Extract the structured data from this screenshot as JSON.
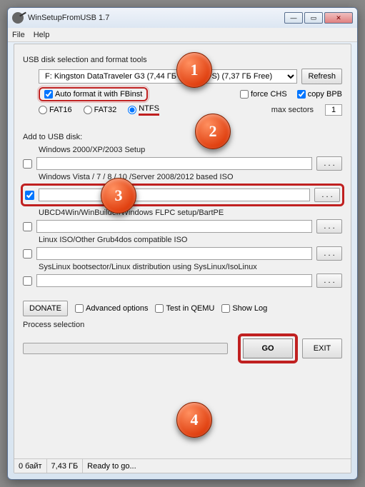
{
  "title": "WinSetupFromUSB 1.7",
  "menu": {
    "file": "File",
    "help": "Help"
  },
  "section1": "USB disk selection and format tools",
  "drive": "F: Kingston DataTraveler G3 (7,44 ГБ Tot) (NTFS) (7,37 ГБ Free)",
  "refresh": "Refresh",
  "autoformat": "Auto format it with FBinst",
  "forceCHS": "force CHS",
  "copyBPB": "copy BPB",
  "fs": {
    "fat16": "FAT16",
    "fat32": "FAT32",
    "ntfs": "NTFS"
  },
  "maxsectors_label": "max sectors",
  "maxsectors_val": "1",
  "section2": "Add to USB disk:",
  "opt1": {
    "label": "Windows 2000/XP/2003 Setup"
  },
  "opt2": {
    "label": "Windows Vista / 7 / 8 / 10 /Server 2008/2012 based ISO"
  },
  "opt3": {
    "label": "UBCD4Win/WinBuilder/Windows FLPC setup/BartPE"
  },
  "opt4": {
    "label": "Linux ISO/Other Grub4dos compatible ISO"
  },
  "opt5": {
    "label": "SysLinux bootsector/Linux distribution using SysLinux/IsoLinux"
  },
  "donate": "DONATE",
  "advopt": "Advanced options",
  "testqemu": "Test in QEMU",
  "showlog": "Show Log",
  "procsel": "Process selection",
  "go": "GO",
  "exit": "EXIT",
  "status": {
    "s1": "0 байт",
    "s2": "7,43 ГБ",
    "s3": "Ready to go..."
  },
  "dots": ". . .",
  "callouts": {
    "c1": "1",
    "c2": "2",
    "c3": "3",
    "c4": "4"
  }
}
